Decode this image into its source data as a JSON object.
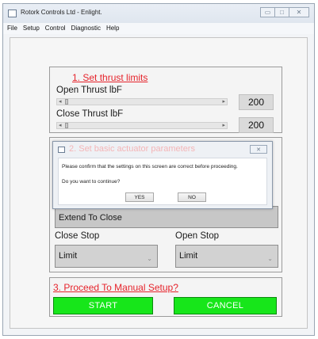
{
  "window": {
    "title": "Rotork Controls Ltd - Enlight.",
    "buttons": {
      "minimize": "▭",
      "restore": "□",
      "close": "✕"
    }
  },
  "menu": [
    "File",
    "Setup",
    "Control",
    "Diagnostic",
    "Help"
  ],
  "section1": {
    "title": "1. Set thrust limits",
    "open": {
      "label": "Open  Thrust lbF",
      "value": "200",
      "left_arrow": "◂",
      "right_arrow": "▸"
    },
    "close": {
      "label": "Close  Thrust lbF",
      "value": "200",
      "left_arrow": "◂",
      "right_arrow": "▸"
    }
  },
  "section2": {
    "extend_label": "Extend To Close",
    "close_stop_label": "Close Stop",
    "open_stop_label": "Open Stop",
    "close_stop_value": "Limit",
    "open_stop_value": "Limit"
  },
  "section3": {
    "title": "3. Proceed To Manual Setup?",
    "start_label": "START",
    "cancel_label": "CANCEL"
  },
  "dialog": {
    "faded_title": "2. Set basic actuator parameters",
    "close_glyph": "✕",
    "message": "Please confirm that the settings on this screen are correct before proceeding.",
    "question": "Do you want to continue?",
    "yes_label": "YES",
    "no_label": "NO"
  },
  "colors": {
    "accent_red": "#e6232b",
    "button_green": "#17e61a"
  }
}
